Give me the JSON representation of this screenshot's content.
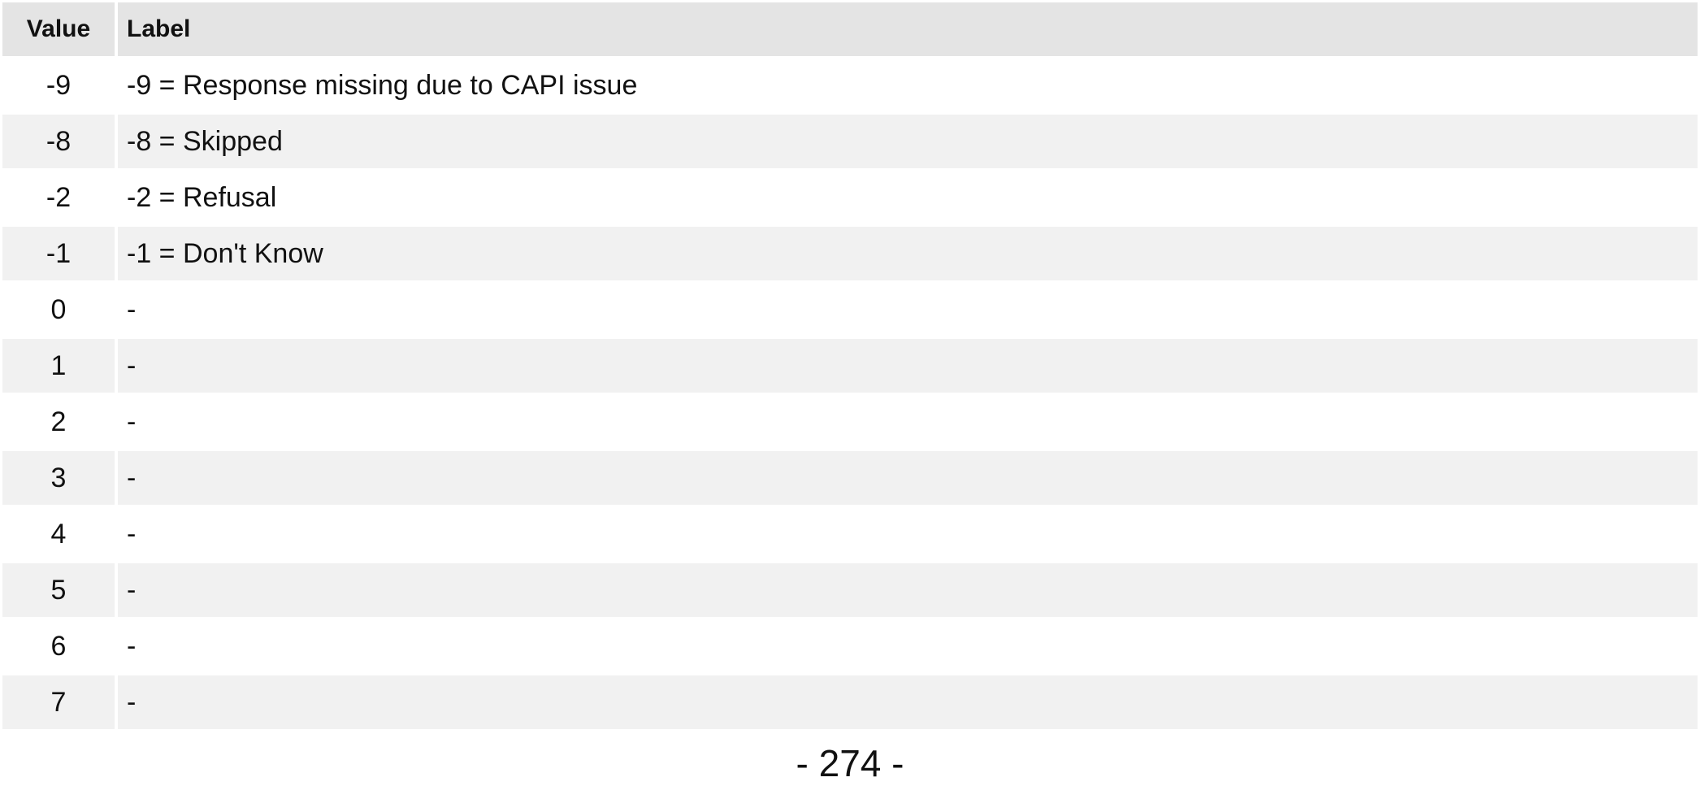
{
  "table": {
    "headers": {
      "value": "Value",
      "label": "Label"
    },
    "rows": [
      {
        "value": "-9",
        "label": "-9 = Response missing due to CAPI issue"
      },
      {
        "value": "-8",
        "label": "-8 = Skipped"
      },
      {
        "value": "-2",
        "label": "-2 = Refusal"
      },
      {
        "value": "-1",
        "label": "-1 = Don't Know"
      },
      {
        "value": "0",
        "label": "-"
      },
      {
        "value": "1",
        "label": "-"
      },
      {
        "value": "2",
        "label": "-"
      },
      {
        "value": "3",
        "label": "-"
      },
      {
        "value": "4",
        "label": "-"
      },
      {
        "value": "5",
        "label": "-"
      },
      {
        "value": "6",
        "label": "-"
      },
      {
        "value": "7",
        "label": "-"
      }
    ]
  },
  "page_number": "- 274 -"
}
